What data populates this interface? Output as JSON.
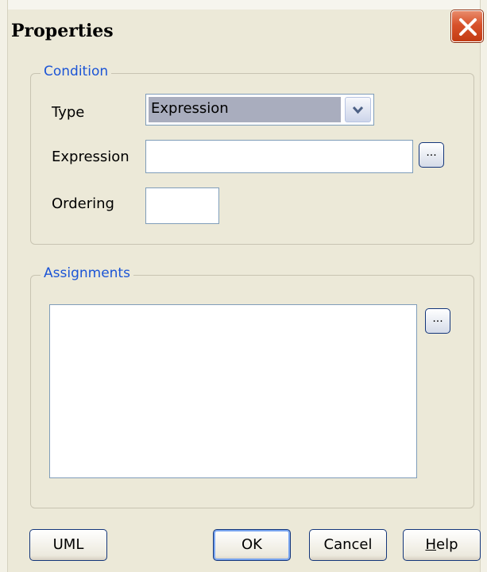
{
  "window": {
    "title": "Properties"
  },
  "condition": {
    "legend": "Condition",
    "type_label": "Type",
    "type_value": "Expression",
    "expression_label": "Expression",
    "expression_value": "",
    "ordering_label": "Ordering",
    "ordering_value": "",
    "browse_label": "..."
  },
  "assignments": {
    "legend": "Assignments",
    "value": "",
    "browse_label": "..."
  },
  "buttons": {
    "uml": "UML",
    "ok": "OK",
    "cancel": "Cancel",
    "help_mnemonic": "H",
    "help_rest": "elp"
  },
  "icons": {
    "close": "close-icon",
    "dropdown": "chevron-down-icon"
  },
  "colors": {
    "dialog_bg": "#ece9d8",
    "legend_text": "#1c55d6",
    "close_button": "#d8522b",
    "selection": "#a9adbe"
  }
}
